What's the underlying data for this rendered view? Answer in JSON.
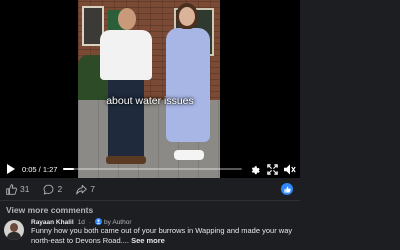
{
  "video": {
    "caption": "about water issues",
    "time": "0:05 / 1:27",
    "progress_fraction": 0.06,
    "controls": {
      "play": "play-icon",
      "settings": "gear-icon",
      "fullscreen": "fullscreen-icon",
      "volume": "volume-icon"
    }
  },
  "reactions": {
    "likes": "31",
    "comments": "2",
    "shares": "7"
  },
  "comments_section": {
    "view_more": "View more comments",
    "items": [
      {
        "author": "Rayaan Khalil",
        "time": "1d",
        "badge": "by Author",
        "text": "Funny how you both came out of your burrows in Wapping and made your way north-east to Devons Road....",
        "see_more": "See more"
      }
    ]
  },
  "colors": {
    "background": "#1c1e21",
    "accent": "#2d88ff",
    "text": "#e4e6eb",
    "muted": "#b0b3b8"
  }
}
